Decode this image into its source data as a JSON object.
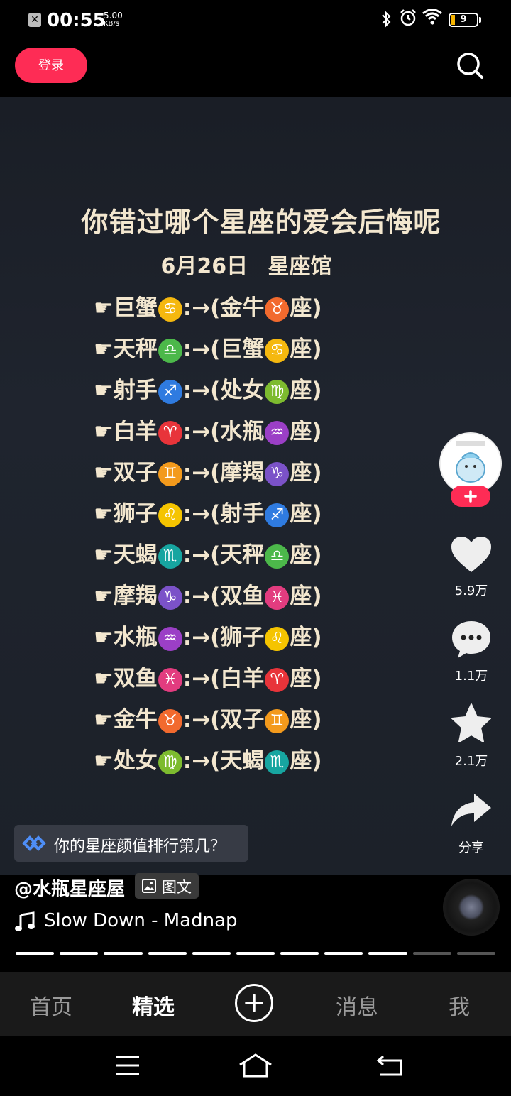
{
  "status_bar": {
    "time": "00:55",
    "net_speed_value": "5.00",
    "net_speed_unit": "KB/s",
    "battery": "9"
  },
  "top_bar": {
    "login_label": "登录"
  },
  "post": {
    "title": "你错过哪个星座的爱会后悔呢",
    "subtitle": "6月26日 星座馆",
    "pairs": [
      {
        "a": "巨蟹",
        "a_sym": "♋",
        "a_color": "#f5b80f",
        "b": "金牛",
        "b_sym": "♉",
        "b_color": "#f26a2e"
      },
      {
        "a": "天秤",
        "a_sym": "♎",
        "a_color": "#4cb84a",
        "b": "巨蟹",
        "b_sym": "♋",
        "b_color": "#f5b80f"
      },
      {
        "a": "射手",
        "a_sym": "♐",
        "a_color": "#2f7be0",
        "b": "处女",
        "b_sym": "♍",
        "b_color": "#7dbb2f"
      },
      {
        "a": "白羊",
        "a_sym": "♈",
        "a_color": "#e8343a",
        "b": "水瓶",
        "b_sym": "♒",
        "b_color": "#9b3fc6"
      },
      {
        "a": "双子",
        "a_sym": "♊",
        "a_color": "#f39a1c",
        "b": "摩羯",
        "b_sym": "♑",
        "b_color": "#7b52c8"
      },
      {
        "a": "狮子",
        "a_sym": "♌",
        "a_color": "#f5c400",
        "b": "射手",
        "b_sym": "♐",
        "b_color": "#2f7be0"
      },
      {
        "a": "天蝎",
        "a_sym": "♏",
        "a_color": "#17a5a0",
        "b": "天秤",
        "b_sym": "♎",
        "b_color": "#4cb84a"
      },
      {
        "a": "摩羯",
        "a_sym": "♑",
        "a_color": "#7b52c8",
        "b": "双鱼",
        "b_sym": "♓",
        "b_color": "#e23c7f"
      },
      {
        "a": "水瓶",
        "a_sym": "♒",
        "a_color": "#9b3fc6",
        "b": "狮子",
        "b_sym": "♌",
        "b_color": "#f5c400"
      },
      {
        "a": "双鱼",
        "a_sym": "♓",
        "a_color": "#e23c7f",
        "b": "白羊",
        "b_sym": "♈",
        "b_color": "#e8343a"
      },
      {
        "a": "金牛",
        "a_sym": "♉",
        "a_color": "#f26a2e",
        "b": "双子",
        "b_sym": "♊",
        "b_color": "#f39a1c"
      },
      {
        "a": "处女",
        "a_sym": "♍",
        "a_color": "#7dbb2f",
        "b": "天蝎",
        "b_sym": "♏",
        "b_color": "#17a5a0"
      }
    ],
    "pointer": "☛",
    "arrow": ":→(",
    "suffix": "座)",
    "topic": "你的星座颜值排行第几？",
    "author": "@水瓶星座屋",
    "tag_label": "图文",
    "music": "Slow Down - Madnap",
    "progress": {
      "segments": 11,
      "completed": 9
    }
  },
  "actions": {
    "like_count": "5.9万",
    "comment_count": "1.1万",
    "favorite_count": "2.1万",
    "share_label": "分享"
  },
  "bottom_nav": {
    "home": "首页",
    "featured": "精选",
    "messages": "消息",
    "me": "我"
  },
  "colors": {
    "brand": "#fe2c55",
    "text_gold": "#f3e7cf"
  }
}
